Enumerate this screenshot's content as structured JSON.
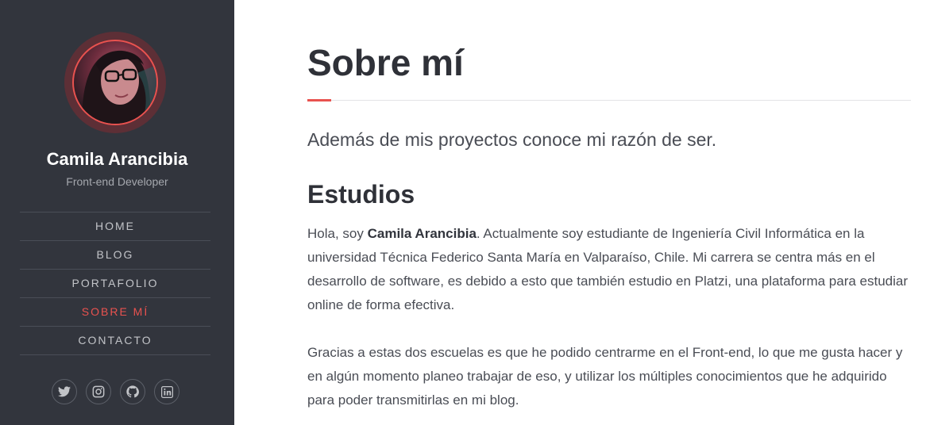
{
  "sidebar": {
    "name": "Camila Arancibia",
    "role": "Front-end Developer",
    "nav": [
      {
        "label": "HOME",
        "active": false
      },
      {
        "label": "BLOG",
        "active": false
      },
      {
        "label": "PORTAFOLIO",
        "active": false
      },
      {
        "label": "SOBRE MÍ",
        "active": true
      },
      {
        "label": "CONTACTO",
        "active": false
      }
    ],
    "socials": [
      "twitter-icon",
      "instagram-icon",
      "github-icon",
      "linkedin-icon"
    ]
  },
  "main": {
    "title": "Sobre mí",
    "lead": "Además de mis proyectos conoce mi razón de ser.",
    "section_title": "Estudios",
    "p1_before": "Hola, soy ",
    "p1_bold": "Camila Arancibia",
    "p1_after": ". Actualmente soy estudiante de Ingeniería Civil Informática en la universidad Técnica Federico Santa María en Valparaíso, Chile. Mi carrera se centra más en el desarrollo de software, es debido a esto que también estudio en Platzi, una plataforma para estudiar online de forma efectiva.",
    "p2": "Gracias a estas dos escuelas es que he podido centrarme en el Front-end, lo que me gusta hacer y en algún momento planeo trabajar de eso, y utilizar los múltiples conocimientos que he adquirido para poder transmitirlas en mi blog."
  },
  "colors": {
    "sidebar_bg": "#32353d",
    "accent": "#e9524f"
  }
}
